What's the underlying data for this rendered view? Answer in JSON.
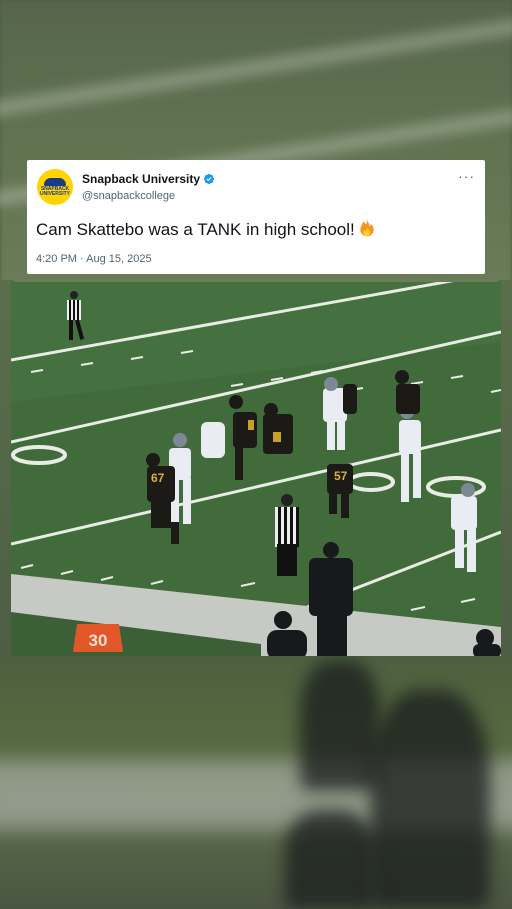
{
  "tweet": {
    "avatar_text": "SNAPBACK UNIVERSITY",
    "display_name": "Snapback University",
    "handle": "@snapbackcollege",
    "more_icon": "···",
    "text": "Cam Skattebo was a TANK in high school!",
    "timestamp": "4:20 PM · Aug 15, 2025"
  },
  "video": {
    "yard_marker": "30",
    "jersey_numbers": [
      "67",
      "57"
    ]
  },
  "colors": {
    "brand_yellow": "#ffd400",
    "verified_blue": "#1d9bf0",
    "field_green": "#3f6a3c"
  }
}
